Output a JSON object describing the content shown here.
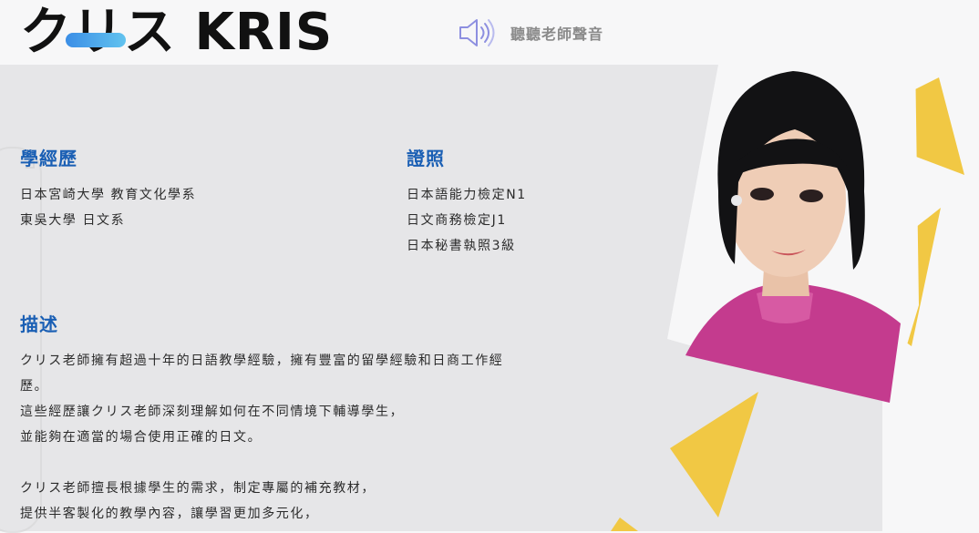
{
  "header": {
    "teacher_name": "クリス KRIS",
    "voice_label": "聽聽老師聲音",
    "voice_icon": "speaker-icon"
  },
  "education": {
    "title": "學經歷",
    "items": [
      "日本宮崎大學 教育文化學系",
      "東吳大學 日文系"
    ]
  },
  "certificates": {
    "title": "證照",
    "items": [
      "日本語能力檢定N1",
      "日文商務檢定J1",
      "日本秘書執照3級"
    ]
  },
  "description": {
    "title": "描述",
    "lines": [
      "クリス老師擁有超過十年的日語教學經驗，擁有豐富的留學經驗和日商工作經",
      "歷。",
      "這些經歷讓クリス老師深刻理解如何在不同情境下輔導學生，",
      "並能夠在適當的場合使用正確的日文。",
      "",
      "クリス老師擅長根據學生的需求，制定專屬的補充教材，",
      "提供半客製化的教學內容，讓學習更加多元化，"
    ]
  },
  "colors": {
    "accent_blue": "#1a5fb4",
    "triangle_yellow": "#f1c844",
    "panel_gray": "#e6e6e8",
    "speaker_purple": "#8d8fe0"
  }
}
